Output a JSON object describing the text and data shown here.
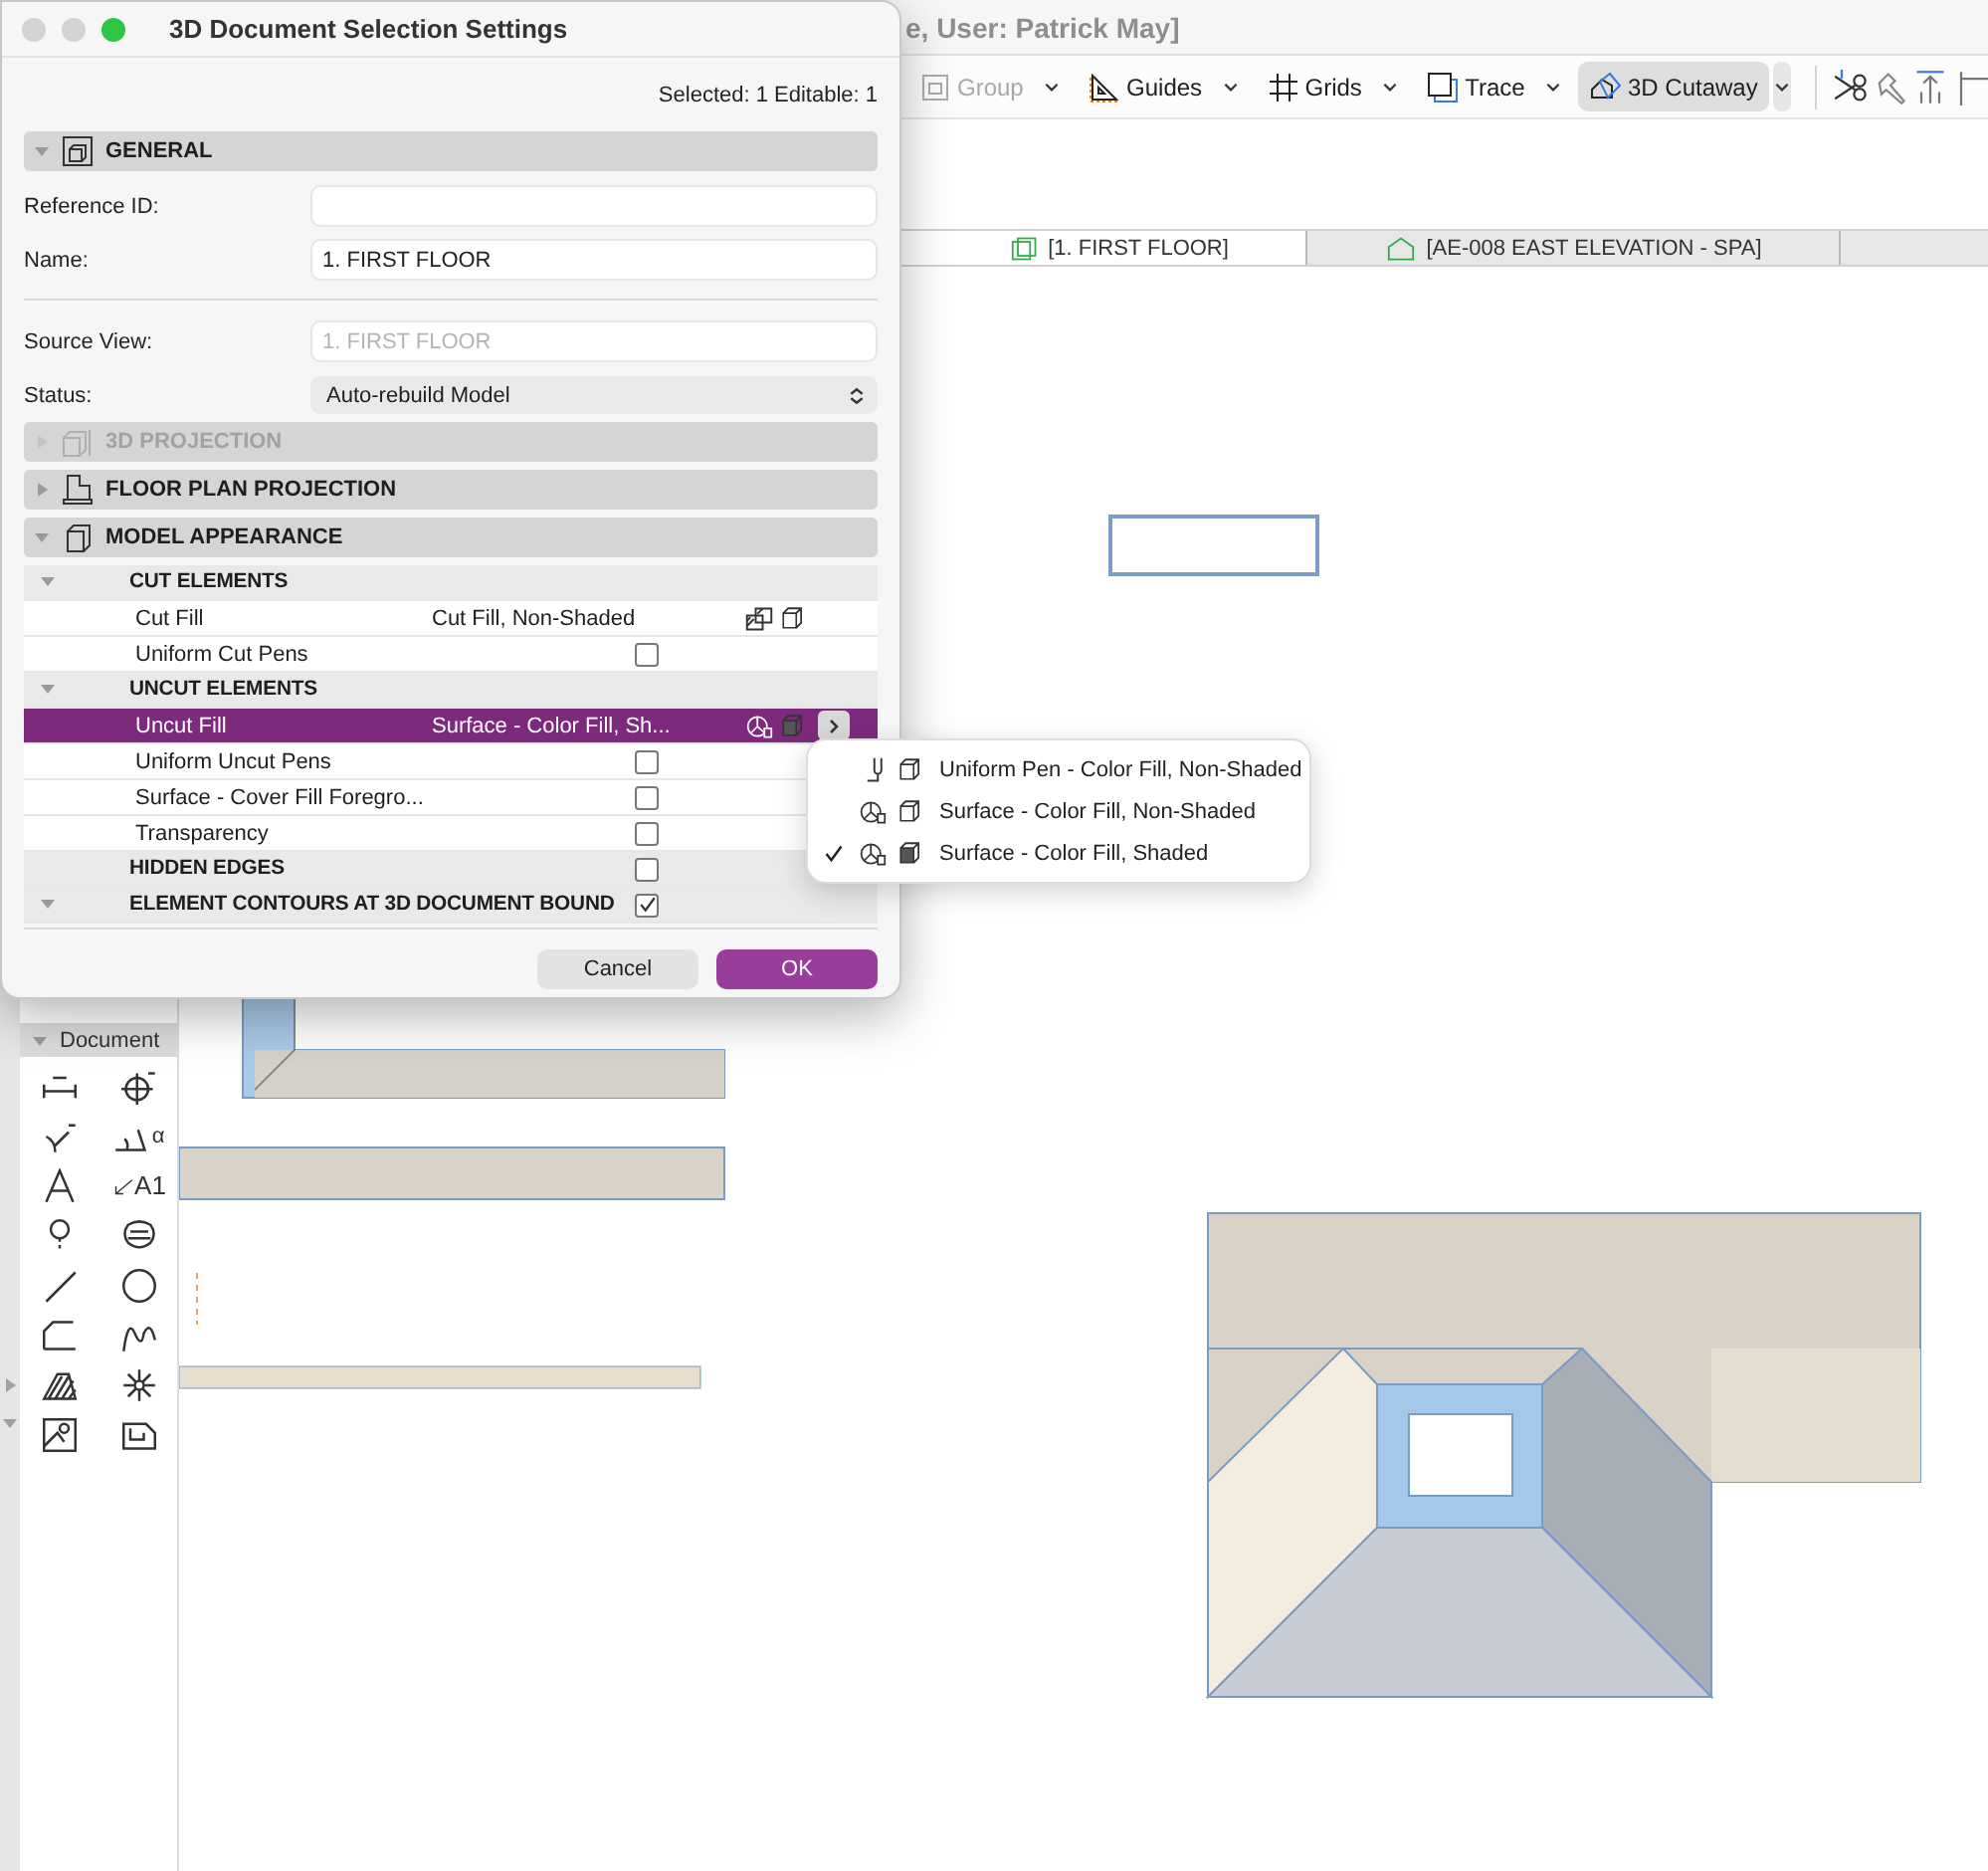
{
  "window": {
    "title": "e, User: Patrick May]"
  },
  "toolbar": [
    {
      "label": "Group",
      "kind": "group",
      "disabled": true,
      "selected": false
    },
    {
      "label": "Guides",
      "kind": "guides",
      "disabled": false,
      "selected": false
    },
    {
      "label": "Grids",
      "kind": "grids",
      "disabled": false,
      "selected": false
    },
    {
      "label": "Trace",
      "kind": "trace",
      "disabled": false,
      "selected": false
    },
    {
      "label": "3D Cutaway",
      "kind": "cutaway",
      "disabled": false,
      "selected": true
    }
  ],
  "tabs": [
    {
      "label": "[1. FIRST FLOOR]",
      "kind": "floor",
      "selected": true
    },
    {
      "label": "[AE-008 EAST ELEVATION - SPA]",
      "kind": "elevation",
      "selected": false
    }
  ],
  "toolbox": {
    "title": "Document",
    "expanded": true,
    "tools": [
      {
        "kind": "dimension"
      },
      {
        "kind": "level"
      },
      {
        "kind": "radial"
      },
      {
        "kind": "angle",
        "text": "α"
      },
      {
        "kind": "text"
      },
      {
        "kind": "label",
        "text": "A1"
      },
      {
        "kind": "marker"
      },
      {
        "kind": "fill"
      },
      {
        "kind": "line"
      },
      {
        "kind": "circle"
      },
      {
        "kind": "polyline"
      },
      {
        "kind": "spline"
      },
      {
        "kind": "hatch"
      },
      {
        "kind": "hotspot"
      },
      {
        "kind": "picture"
      },
      {
        "kind": "drawing"
      }
    ]
  },
  "dialog": {
    "title": "3D Document Selection Settings",
    "selection_info": "Selected: 1 Editable: 1",
    "general": {
      "label": "GENERAL",
      "expanded": true
    },
    "fields_top": [
      {
        "label": "Reference ID:",
        "kind": "text"
      },
      {
        "label": "Name:",
        "kind": "text",
        "value": "1. FIRST FLOOR"
      }
    ],
    "fields_bottom": [
      {
        "label": "Source View:",
        "kind": "text",
        "placeholder": "1. FIRST FLOOR"
      },
      {
        "label": "Status:",
        "kind": "select",
        "value": "Auto-rebuild Model"
      }
    ],
    "sections": [
      {
        "label": "3D PROJECTION",
        "kind": "projection",
        "expanded": false,
        "disabled": true
      },
      {
        "label": "FLOOR PLAN PROJECTION",
        "kind": "floorplan",
        "expanded": false,
        "disabled": false
      },
      {
        "label": "MODEL APPEARANCE",
        "kind": "model",
        "expanded": true,
        "disabled": false
      }
    ],
    "rows": [
      {
        "kind": "group",
        "label": "CUT ELEMENTS",
        "expanded": true,
        "selected": false
      },
      {
        "kind": "cutfill",
        "label": "Cut Fill",
        "value": "Cut Fill, Non-Shaded",
        "shaded": false,
        "selected": false
      },
      {
        "kind": "check",
        "label": "Uniform Cut Pens",
        "checked": false,
        "selected": false
      },
      {
        "kind": "group",
        "label": "UNCUT ELEMENTS",
        "expanded": true,
        "selected": false
      },
      {
        "kind": "surfacefill",
        "label": "Uncut Fill",
        "value": "Surface - Color Fill, Sh...",
        "shaded": true,
        "selected": true
      },
      {
        "kind": "check",
        "label": "Uniform Uncut Pens",
        "checked": false,
        "selected": false
      },
      {
        "kind": "check",
        "label": "Surface - Cover Fill Foregro...",
        "checked": false,
        "selected": false
      },
      {
        "kind": "check",
        "label": "Transparency",
        "checked": false,
        "selected": false
      },
      {
        "kind": "groupcheck",
        "label": "HIDDEN EDGES",
        "checked": false,
        "selected": false
      },
      {
        "kind": "group",
        "label": "ELEMENT CONTOURS AT 3D DOCUMENT BOUND",
        "expanded": true,
        "checked": true,
        "selected": false
      }
    ],
    "buttons": [
      {
        "label": "Cancel",
        "kind": "secondary"
      },
      {
        "label": "OK",
        "kind": "primary"
      }
    ]
  },
  "menu": {
    "items": [
      {
        "label": "Uniform Pen - Color Fill, Non-Shaded",
        "kind": "pen",
        "shaded": false,
        "checked": false
      },
      {
        "label": "Surface - Color Fill, Non-Shaded",
        "kind": "surface",
        "shaded": false,
        "checked": false
      },
      {
        "label": "Surface - Color Fill, Shaded",
        "kind": "surface",
        "shaded": true,
        "checked": true
      }
    ]
  }
}
